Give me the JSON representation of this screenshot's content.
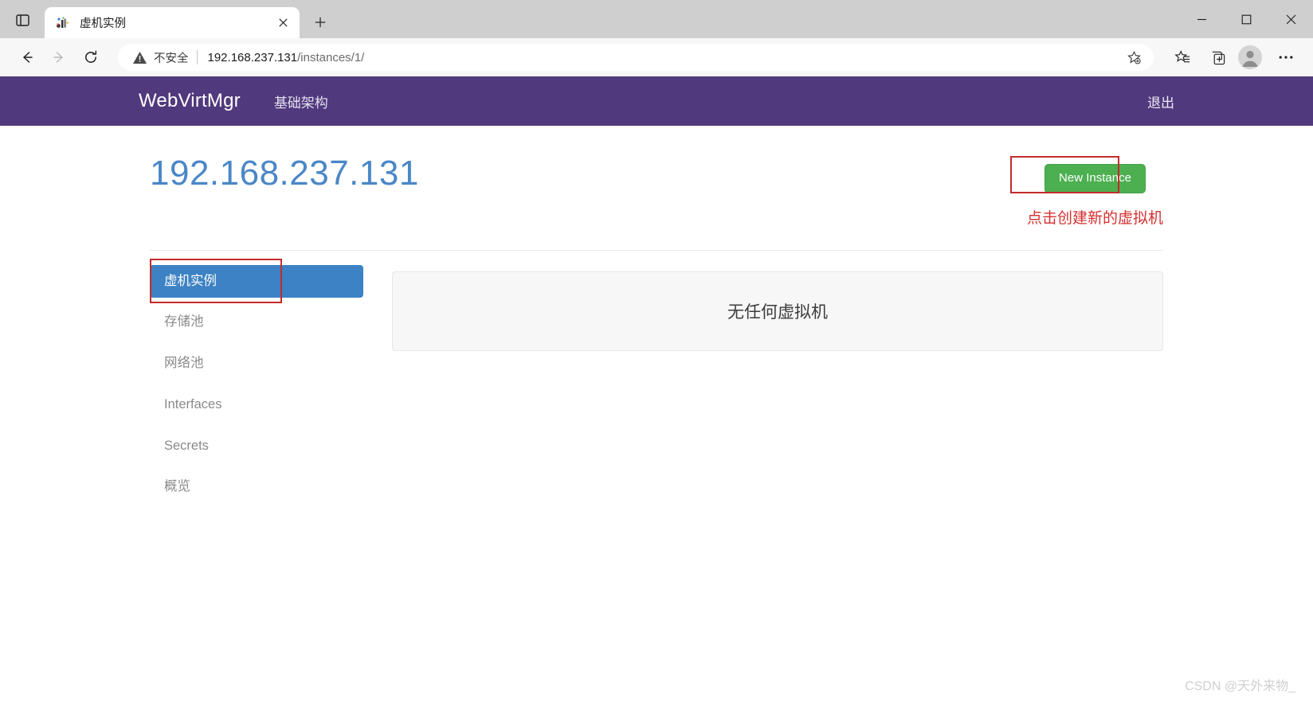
{
  "browser": {
    "tab": {
      "title": "虚机实例",
      "favicon_name": "webvirtmgr-favicon",
      "close_label": "✕"
    },
    "new_tab_label": "+",
    "sidebar_toggle_name": "tab-sidebar-icon",
    "window_controls": {
      "minimize": "—",
      "maximize": "▢",
      "close": "✕"
    },
    "toolbar": {
      "back_label": "←",
      "forward_label": "→",
      "reload_label": "⟳",
      "security_text": "不安全",
      "url_host": "192.168.237.131",
      "url_path": "/instances/1/",
      "favorite_icon": "add-favorite-icon",
      "favorites_icon": "favorites-list-icon",
      "collections_icon": "collections-icon",
      "profile_icon": "profile-avatar-icon",
      "settings_icon": "more-settings-icon"
    }
  },
  "navbar": {
    "brand": "WebVirtMgr",
    "links": [
      {
        "label": "基础架构"
      }
    ],
    "logout_label": "退出",
    "background": "#51397d"
  },
  "header": {
    "title": "192.168.237.131",
    "title_color": "#4a87c7",
    "new_instance_label": "New Instance",
    "new_instance_color": "#4caf50"
  },
  "annotations": {
    "color": "#c42b2b",
    "new_instance_note": "点击创建新的虚拟机"
  },
  "sidebar": {
    "items": [
      {
        "label": "虚机实例",
        "active": true
      },
      {
        "label": "存储池",
        "active": false
      },
      {
        "label": "网络池",
        "active": false
      },
      {
        "label": "Interfaces",
        "active": false
      },
      {
        "label": "Secrets",
        "active": false
      },
      {
        "label": "概览",
        "active": false
      }
    ],
    "active_color": "#3d82c4"
  },
  "main": {
    "empty_message": "无任何虚拟机"
  },
  "watermark": "CSDN @天外来物_"
}
